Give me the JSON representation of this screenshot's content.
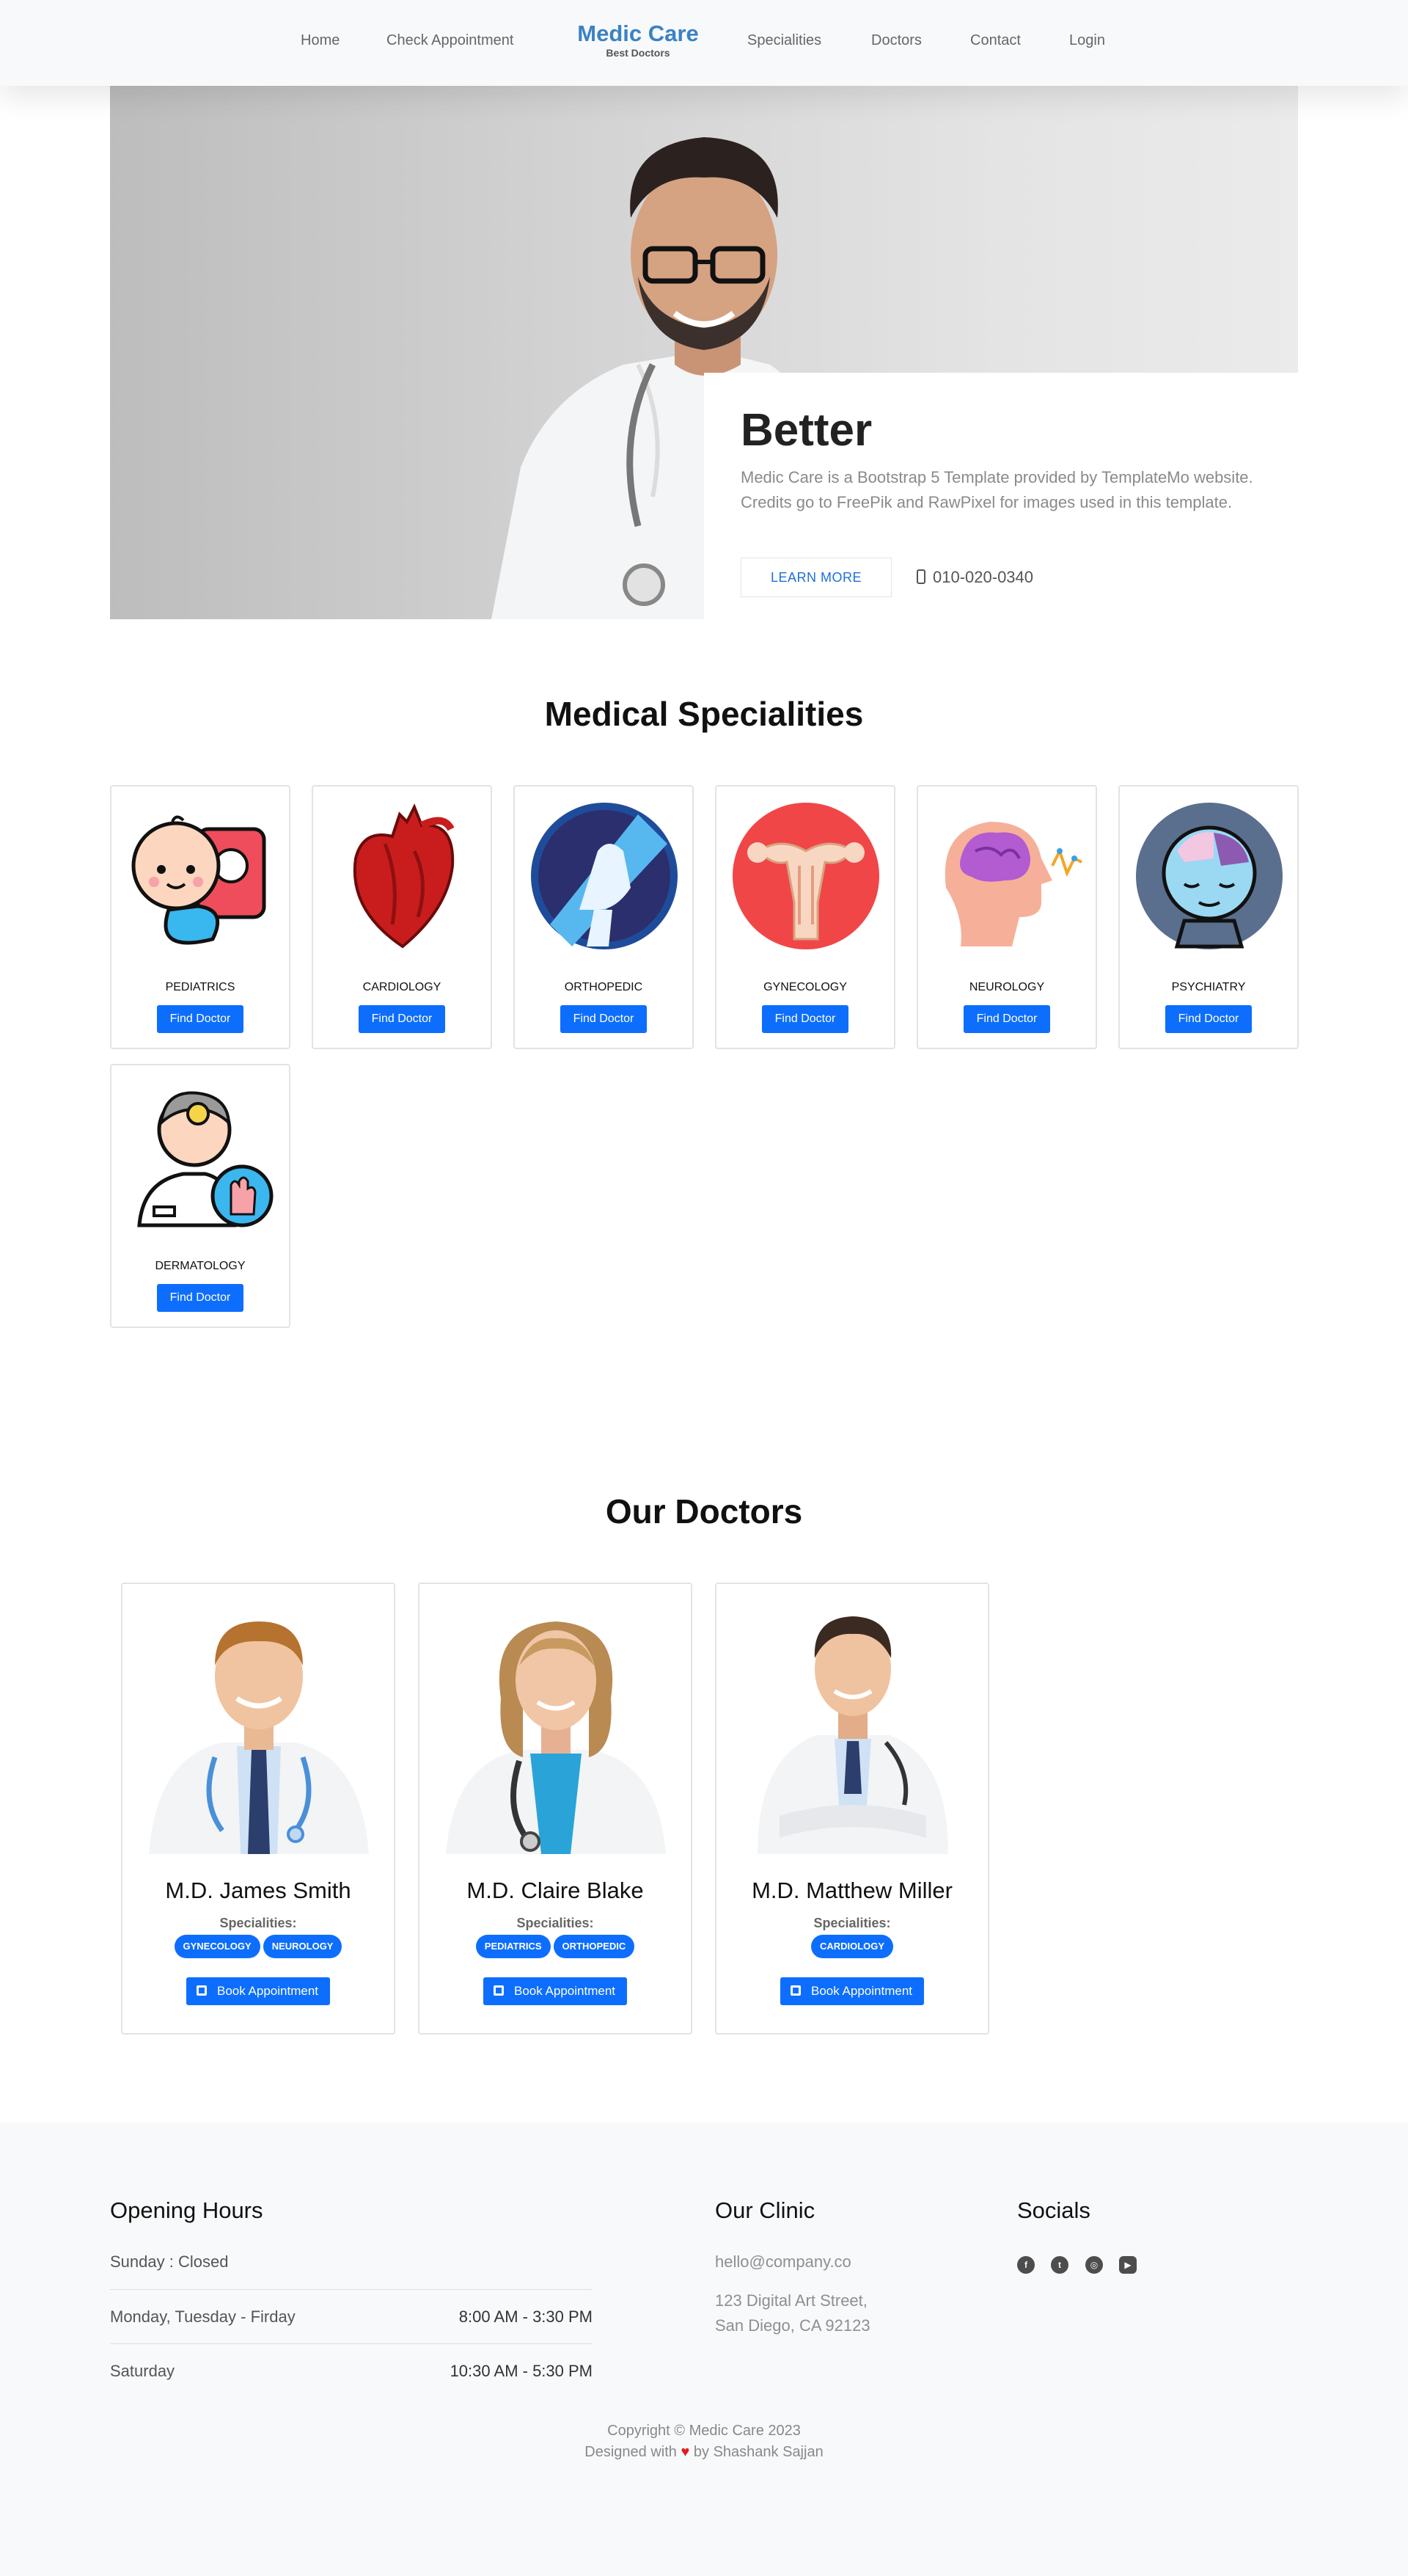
{
  "nav": {
    "home": "Home",
    "check_appointment": "Check Appointment",
    "brand_title": "Medic Care",
    "brand_subtitle": "Best Doctors",
    "specialities": "Specialities",
    "doctors": "Doctors",
    "contact": "Contact",
    "login": "Login"
  },
  "hero": {
    "title": "Better",
    "text": "Medic Care is a Bootstrap 5 Template provided by TemplateMo website. Credits go to FreePik and RawPixel for images used in this template.",
    "button": "LEARN MORE",
    "phone": "010-020-0340"
  },
  "specialities": {
    "title": "Medical Specialities",
    "button": "Find Doctor",
    "items": [
      {
        "name": "PEDIATRICS",
        "icon": "pediatrics-icon"
      },
      {
        "name": "CARDIOLOGY",
        "icon": "heart-icon"
      },
      {
        "name": "ORTHOPEDIC",
        "icon": "knee-bone-icon"
      },
      {
        "name": "GYNECOLOGY",
        "icon": "uterus-icon"
      },
      {
        "name": "NEUROLOGY",
        "icon": "brain-icon"
      },
      {
        "name": "PSYCHIATRY",
        "icon": "mind-puzzle-icon"
      },
      {
        "name": "DERMATOLOGY",
        "icon": "dermatologist-icon"
      }
    ]
  },
  "doctors": {
    "title": "Our Doctors",
    "spec_label": "Specialities:",
    "book_label": "Book Appointment",
    "items": [
      {
        "name": "M.D. James Smith",
        "badges": [
          "GYNECOLOGY",
          "NEUROLOGY"
        ]
      },
      {
        "name": "M.D. Claire Blake",
        "badges": [
          "PEDIATRICS",
          "ORTHOPEDIC"
        ]
      },
      {
        "name": "M.D. Matthew Miller",
        "badges": [
          "CARDIOLOGY"
        ]
      }
    ]
  },
  "footer": {
    "hours_title": "Opening Hours",
    "hours": [
      {
        "day": "Sunday : Closed",
        "time": ""
      },
      {
        "day": "Monday, Tuesday - Firday",
        "time": "8:00 AM - 3:30 PM"
      },
      {
        "day": "Saturday",
        "time": "10:30 AM - 5:30 PM"
      }
    ],
    "clinic_title": "Our Clinic",
    "email": "hello@company.co",
    "address_line1": "123 Digital Art Street,",
    "address_line2": "San Diego, CA 92123",
    "socials_title": "Socials",
    "socials": [
      "facebook-icon",
      "twitter-icon",
      "instagram-icon",
      "youtube-icon"
    ],
    "copyright": "Copyright © Medic Care 2023",
    "designed_prefix": "Designed with",
    "designed_suffix": "by Shashank Sajjan"
  },
  "colors": {
    "primary": "#0d6efd",
    "brand": "#3b82c4",
    "nav_bg": "#f8f9fa",
    "footer_bg": "#f8f9fa"
  }
}
